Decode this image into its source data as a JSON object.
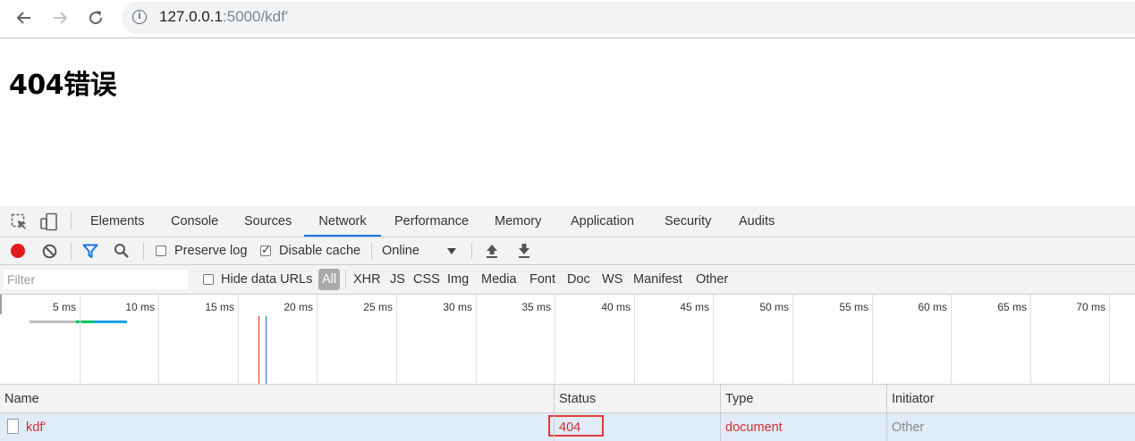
{
  "browser": {
    "url_host": "127.0.0.1",
    "url_rest": ":5000/kdf'"
  },
  "page": {
    "heading": "404错误"
  },
  "devtools": {
    "tabs": [
      "Elements",
      "Console",
      "Sources",
      "Network",
      "Performance",
      "Memory",
      "Application",
      "Security",
      "Audits"
    ],
    "active_tab": "Network",
    "toolbar": {
      "preserve_log_label": "Preserve log",
      "preserve_log_checked": false,
      "disable_cache_label": "Disable cache",
      "disable_cache_checked": true,
      "throttle_value": "Online"
    },
    "filterbar": {
      "filter_placeholder": "Filter",
      "hide_data_urls_label": "Hide data URLs",
      "types": [
        "All",
        "XHR",
        "JS",
        "CSS",
        "Img",
        "Media",
        "Font",
        "Doc",
        "WS",
        "Manifest",
        "Other"
      ],
      "active_type": "All"
    },
    "timeline": {
      "tick_labels": [
        "5 ms",
        "10 ms",
        "15 ms",
        "20 ms",
        "25 ms",
        "30 ms",
        "35 ms",
        "40 ms",
        "45 ms",
        "50 ms",
        "55 ms",
        "60 ms",
        "65 ms",
        "70 ms"
      ],
      "colors": {
        "dom_content_loaded": "#1a73e8",
        "load": "#d93025",
        "bar_waiting": "#0fbf5f",
        "bar_download": "#1aa3e8",
        "bar_queue": "#bdbdbd"
      }
    },
    "table": {
      "columns": [
        "Name",
        "Status",
        "Type",
        "Initiator"
      ],
      "rows": [
        {
          "name": "kdf'",
          "status": "404",
          "type": "document",
          "initiator": "Other"
        }
      ],
      "error_color": "#d32f2f"
    }
  }
}
